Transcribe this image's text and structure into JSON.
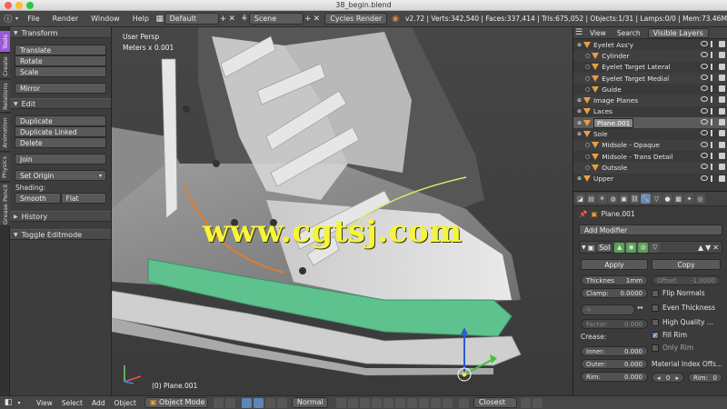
{
  "window": {
    "title": "38_begin.blend"
  },
  "info_header": {
    "menus": [
      "File",
      "Render",
      "Window",
      "Help"
    ],
    "layout": "Default",
    "scene": "Scene",
    "engine": "Cycles Render",
    "stats": "v2.72 | Verts:342,540 | Faces:337,414 | Tris:675,052 | Objects:1/31 | Lamps:0/0 | Mem:73.46M"
  },
  "tool_tabs": [
    "Tools",
    "Create",
    "Relations",
    "Animation",
    "Physics",
    "Grease Pencil"
  ],
  "tool_shelf": {
    "transform_title": "Transform",
    "transform": [
      "Translate",
      "Rotate",
      "Scale"
    ],
    "mirror": "Mirror",
    "edit_title": "Edit",
    "edit": [
      "Duplicate",
      "Duplicate Linked",
      "Delete"
    ],
    "join": "Join",
    "set_origin": "Set Origin",
    "shading_label": "Shading:",
    "smooth": "Smooth",
    "flat": "Flat",
    "history": "History",
    "toggle_editmode": "Toggle Editmode"
  },
  "viewport": {
    "view_name": "User Persp",
    "units": "Meters x 0.001",
    "object_label": "(0) Plane.001",
    "watermark": "www.cgtsj.com"
  },
  "outliner": {
    "tabs": [
      "View",
      "Search",
      "Visible Layers"
    ],
    "rows": [
      {
        "name": "Eyelet Ass'y",
        "indent": 1
      },
      {
        "name": "Cylinder",
        "indent": 2
      },
      {
        "name": "Eyelet Target Lateral",
        "indent": 2
      },
      {
        "name": "Eyelet Target Medial",
        "indent": 2
      },
      {
        "name": "Guide",
        "indent": 2
      },
      {
        "name": "Image Planes",
        "indent": 1
      },
      {
        "name": "Laces",
        "indent": 1
      },
      {
        "name": "Plane.001",
        "indent": 1,
        "editing": true
      },
      {
        "name": "Sole",
        "indent": 1
      },
      {
        "name": "Midsole - Opaque",
        "indent": 2
      },
      {
        "name": "Midsole - Trans Detail",
        "indent": 2
      },
      {
        "name": "Outsole",
        "indent": 2
      },
      {
        "name": "Upper",
        "indent": 1
      }
    ]
  },
  "properties": {
    "object_name": "Plane.001",
    "add_modifier": "Add Modifier",
    "modifier_name": "Sol",
    "apply": "Apply",
    "copy": "Copy",
    "thickness_label": "Thicknes",
    "thickness_value": "1mm",
    "offset_label": "Offset:",
    "offset_value": "-1.0000",
    "clamp_label": "Clamp:",
    "clamp_value": "0.0000",
    "flip_normals": "Flip Normals",
    "even_thickness": "Even Thickness",
    "high_quality": "High Quality ...",
    "fill_rim": "Fill Rim",
    "only_rim": "Only Rim",
    "factor_label": "Factor:",
    "factor_value": "0.000",
    "crease_label": "Crease:",
    "inner_label": "Inner:",
    "inner_value": "0.000",
    "outer_label": "Outer:",
    "outer_value": "0.000",
    "rim_label": "Rim:",
    "rim_value": "0.000",
    "material_index": "Material Index Offs...",
    "mat_left": "0",
    "mat_rim_label": "Rim:",
    "mat_rim_value": "0"
  },
  "bottom_header": {
    "menus": [
      "View",
      "Select",
      "Add",
      "Object"
    ],
    "mode": "Object Mode",
    "pivot": "Normal",
    "snap": "Closest"
  },
  "colors": {
    "purple_tab": "#9a5ad8",
    "sole_green": "#5dc28e",
    "watermark": "#f5f53a",
    "accent_orange": "#e07d2e"
  }
}
